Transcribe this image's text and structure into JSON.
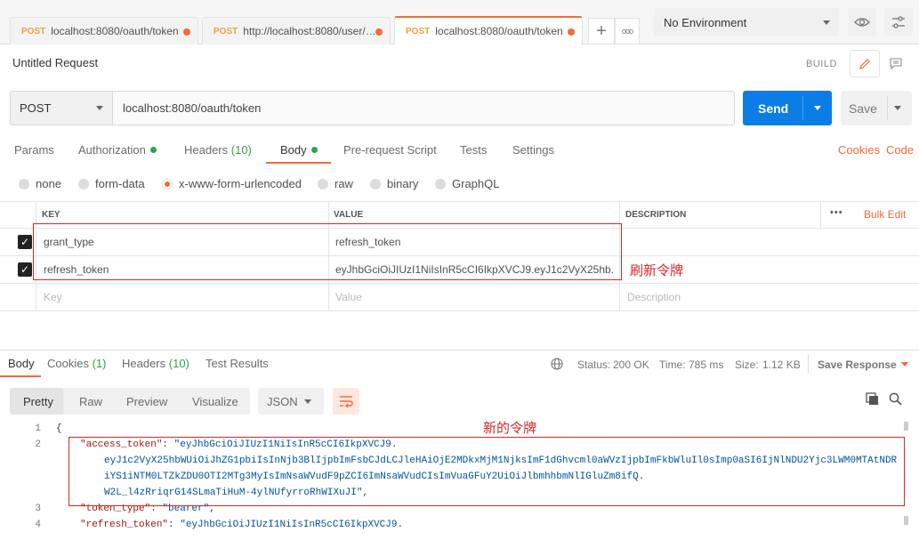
{
  "tabs": [
    {
      "method": "POST",
      "url": "localhost:8080/oauth/token"
    },
    {
      "method": "POST",
      "url": "http://localhost:8080/user/g..."
    },
    {
      "method": "POST",
      "url": "localhost:8080/oauth/token"
    }
  ],
  "more_tabs_label": "ooo",
  "environment": "No Environment",
  "request_title": "Untitled Request",
  "build_label": "BUILD",
  "method": "POST",
  "url": "localhost:8080/oauth/token",
  "send_label": "Send",
  "save_label": "Save",
  "request_tabs": {
    "params": "Params",
    "authorization": "Authorization",
    "headers": "Headers",
    "headers_count": "(10)",
    "body": "Body",
    "prerequest": "Pre-request Script",
    "tests": "Tests",
    "settings": "Settings"
  },
  "cookies_link": "Cookies",
  "code_link": "Code",
  "body_types": [
    "none",
    "form-data",
    "x-www-form-urlencoded",
    "raw",
    "binary",
    "GraphQL"
  ],
  "table": {
    "headers": {
      "key": "KEY",
      "value": "VALUE",
      "description": "DESCRIPTION"
    },
    "more": "•••",
    "bulk_edit": "Bulk Edit",
    "rows": [
      {
        "key": "grant_type",
        "value": "refresh_token"
      },
      {
        "key": "refresh_token",
        "value": "eyJhbGciOiJIUzI1NiIsInR5cCI6IkpXVCJ9.eyJ1c2VyX25hb..."
      }
    ],
    "placeholder": {
      "key": "Key",
      "value": "Value",
      "description": "Description"
    }
  },
  "annotation_refresh": "刷新令牌",
  "annotation_new": "新的令牌",
  "response": {
    "tabs": {
      "body": "Body",
      "cookies": "Cookies",
      "cookies_count": "(1)",
      "headers": "Headers",
      "headers_count": "(10)",
      "test_results": "Test Results"
    },
    "status_label": "Status:",
    "status_value": "200 OK",
    "time_label": "Time:",
    "time_value": "785 ms",
    "size_label": "Size:",
    "size_value": "1.12 KB",
    "save_response": "Save Response",
    "views": [
      "Pretty",
      "Raw",
      "Preview",
      "Visualize"
    ],
    "format": "JSON"
  },
  "code_lines": [
    {
      "n": "1",
      "text": "{"
    },
    {
      "n": "2",
      "key": "\"access_token\"",
      "sep": ": ",
      "val": "\"eyJhbGciOiJIUzI1NiIsInR5cCI6IkpXVCJ9."
    },
    {
      "n": "",
      "val": "eyJ1c2VyX25hbWUiOiJhZG1pbiIsInNjb3BlIjpbImFsbCJdLCJleHAiOjE2MDkxMjM1NjksImF1dGhvcml0aWVzIjpbImFkbWluIl0sImp0aSI6IjNlNDU2Yjc3LWM0MTAtNDR"
    },
    {
      "n": "",
      "val": "iYS1iNTM0LTZkZDU0OTI2MTg3MyIsImNsaWVudF9pZCI6ImNsaWVudCIsImVuaGFuY2UiOiJlbmhhbmNlIGluZm8ifQ."
    },
    {
      "n": "",
      "val": "W2L_l4zRriqrG14SLmaTiHuM-4ylNUfyrroRhWIXuJI\","
    },
    {
      "n": "3",
      "key": "\"token_type\"",
      "sep": ": ",
      "val": "\"bearer\","
    },
    {
      "n": "4",
      "key": "\"refresh_token\"",
      "sep": ": ",
      "val": "\"eyJhbGciOiJIUzI1NiIsInR5cCI6IkpXVCJ9."
    }
  ],
  "colors": {
    "accent": "#f26b3a",
    "send": "#0d7de6",
    "annotation": "#d62828",
    "status_ok": "#2ea44f"
  }
}
